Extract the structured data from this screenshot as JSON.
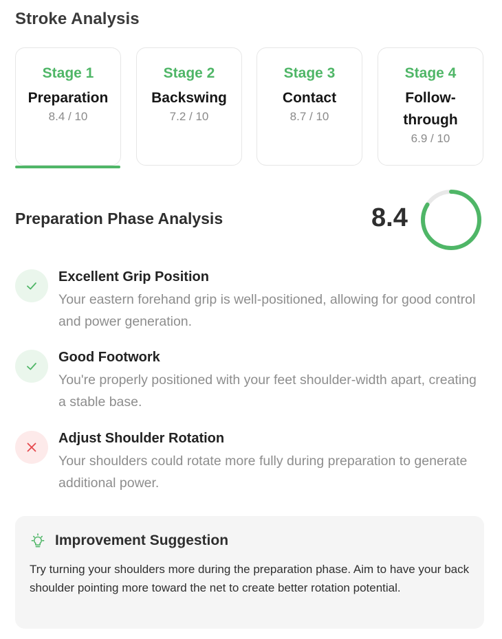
{
  "page": {
    "title": "Stroke Analysis"
  },
  "stages": [
    {
      "num": "Stage 1",
      "name": "Preparation",
      "score": "8.4 / 10"
    },
    {
      "num": "Stage 2",
      "name": "Backswing",
      "score": "7.2 / 10"
    },
    {
      "num": "Stage 3",
      "name": "Contact",
      "score": "8.7 / 10"
    },
    {
      "num": "Stage 4",
      "name": "Follow-through",
      "name_line1": "Follow-",
      "name_line2": "through",
      "score": "6.9 / 10"
    }
  ],
  "active_stage": 0,
  "phase": {
    "title": "Preparation Phase Analysis",
    "score": "8.4",
    "score_fraction": 0.84,
    "accent_color": "#4fb667"
  },
  "feedback": [
    {
      "status": "positive",
      "icon": "check-icon",
      "title": "Excellent Grip Position",
      "text": "Your eastern forehand grip is well-positioned, allowing for good control and power generation."
    },
    {
      "status": "positive",
      "icon": "check-icon",
      "title": "Good Footwork",
      "text": "You're properly positioned with your feet shoulder-width apart, creating a stable base."
    },
    {
      "status": "negative",
      "icon": "x-icon",
      "title": "Adjust Shoulder Rotation",
      "text": "Your shoulders could rotate more fully during preparation to generate additional power."
    }
  ],
  "suggestion": {
    "icon": "lightbulb-icon",
    "title": "Improvement Suggestion",
    "text": "Try turning your shoulders more during the preparation phase. Aim to have your back shoulder pointing more toward the net to create better rotation potential."
  },
  "colors": {
    "positive": "#4fb667",
    "negative": "#e5484d"
  }
}
